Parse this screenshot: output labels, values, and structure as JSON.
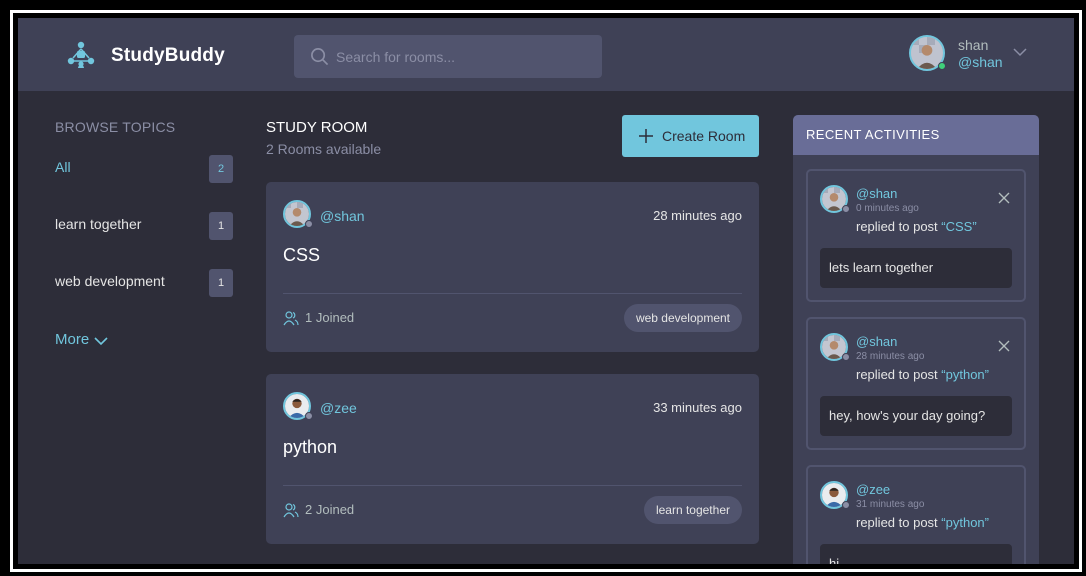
{
  "app": {
    "brand": "StudyBuddy",
    "accent": "#71c6dd",
    "logo_icon": "people-network-icon"
  },
  "search": {
    "placeholder": "Search for rooms...",
    "value": ""
  },
  "user": {
    "name": "shan",
    "handle": "@shan",
    "status": "online"
  },
  "sidebar": {
    "title": "Browse Topics",
    "topics": [
      {
        "label": "All",
        "count": "2",
        "active": true
      },
      {
        "label": "learn together",
        "count": "1",
        "active": false
      },
      {
        "label": "web development",
        "count": "1",
        "active": false
      }
    ],
    "more_label": "More"
  },
  "main": {
    "title": "STUDY ROOM",
    "subtitle": "2 Rooms available",
    "create_label": "Create Room",
    "rooms": [
      {
        "host": "@shan",
        "time": "28 minutes ago",
        "name": "CSS",
        "joined": "1 Joined",
        "topic": "web development"
      },
      {
        "host": "@zee",
        "time": "33 minutes ago",
        "name": "python",
        "joined": "2 Joined",
        "topic": "learn together"
      }
    ]
  },
  "activities": {
    "title": "RECENT ACTIVITIES",
    "items": [
      {
        "user": "@shan",
        "time": "0 minutes ago",
        "action": "replied to post",
        "post": "“CSS”",
        "message": "lets learn together",
        "closable": true
      },
      {
        "user": "@shan",
        "time": "28 minutes ago",
        "action": "replied to post",
        "post": "“python”",
        "message": "hey, how's your day going?",
        "closable": true
      },
      {
        "user": "@zee",
        "time": "31 minutes ago",
        "action": "replied to post",
        "post": "“python”",
        "message": "hi",
        "closable": false
      }
    ]
  }
}
